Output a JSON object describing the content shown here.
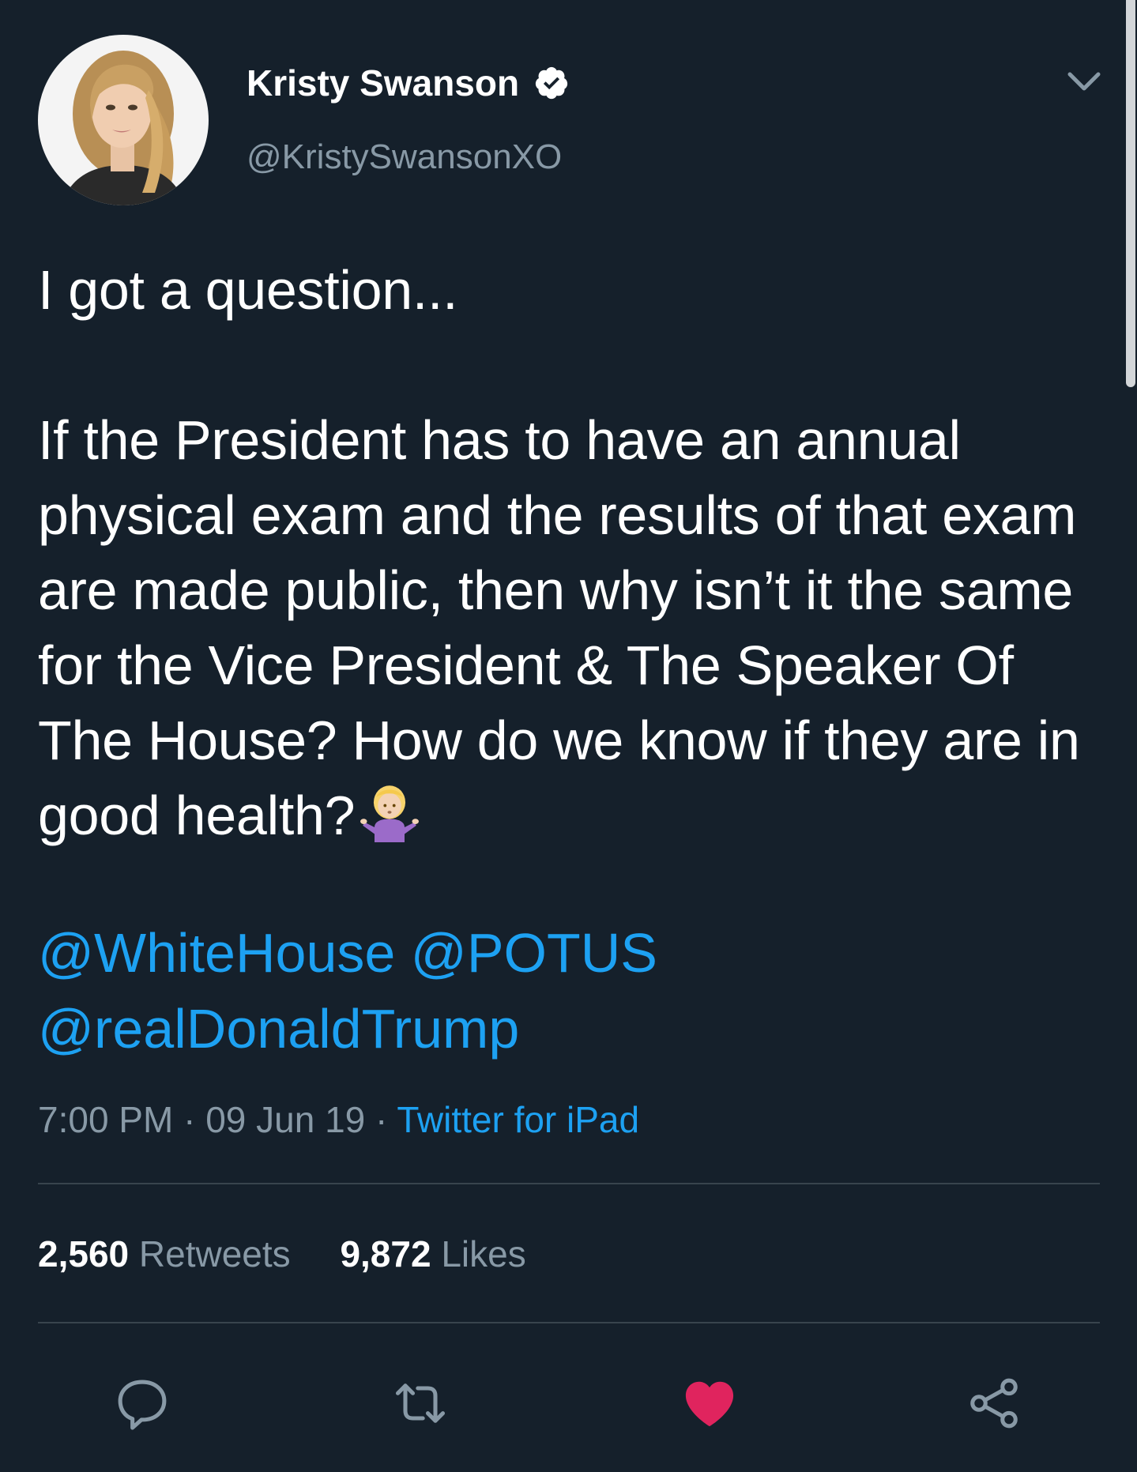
{
  "author": {
    "display_name": "Kristy Swanson",
    "handle": "@KristySwansonXO",
    "verified": true
  },
  "tweet": {
    "intro": "I got a question...",
    "body": "If the President has to have an annual physical exam and the results of that exam are made public, then why isn’t it the same for the Vice President & The Speaker Of The House? How do we know if they are in good health?",
    "emoji": "person-shrugging-emoji",
    "mentions": [
      "@WhiteHouse",
      "@POTUS",
      "@realDonaldTrump"
    ]
  },
  "meta": {
    "time": "7:00 PM",
    "separator": "·",
    "date": "09 Jun 19",
    "source": "Twitter for iPad"
  },
  "stats": {
    "retweets_count": "2,560",
    "retweets_label": "Retweets",
    "likes_count": "9,872",
    "likes_label": "Likes"
  },
  "actions": {
    "reply_icon": "reply-icon",
    "retweet_icon": "retweet-icon",
    "like_icon": "heart-icon",
    "share_icon": "share-icon",
    "liked": true
  },
  "colors": {
    "background": "#15202b",
    "accent": "#1da1f2",
    "muted": "#8899a6",
    "like": "#e0245e",
    "divider": "#38444d"
  }
}
